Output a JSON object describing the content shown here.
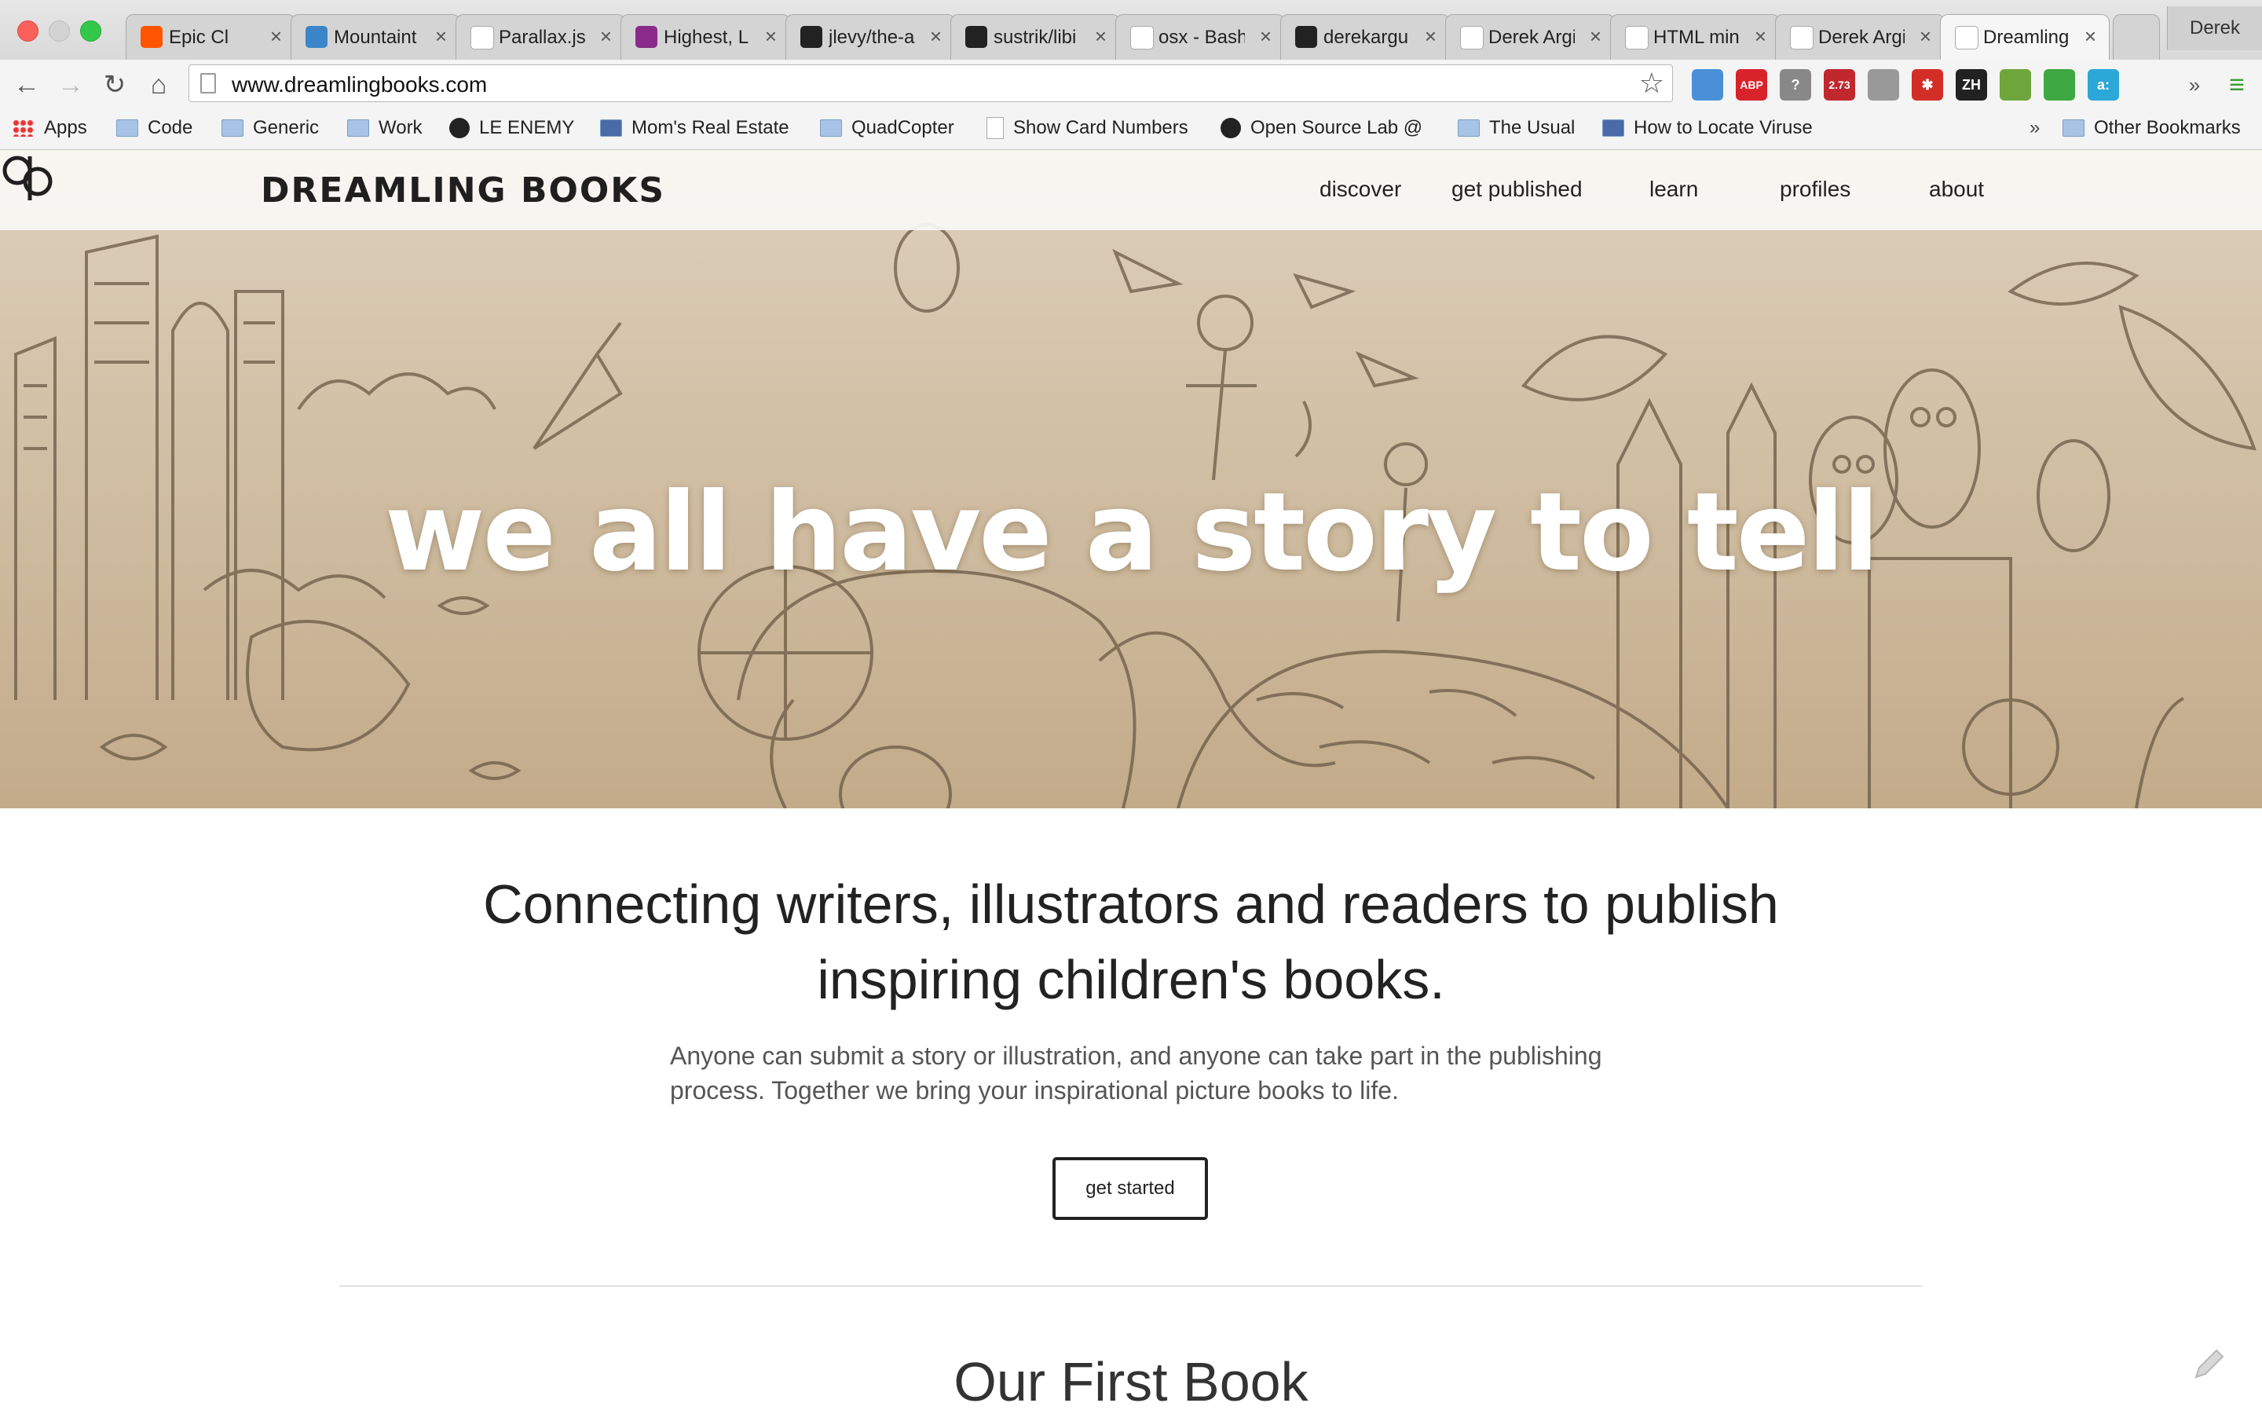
{
  "browser": {
    "tabs": [
      {
        "title": "Epic Cl",
        "favicon": "soundcloud-icon",
        "color": "#ff5500",
        "audio": true
      },
      {
        "title": "Mountaint",
        "favicon": "globe-icon",
        "color": "#3a86c8"
      },
      {
        "title": "Parallax.js",
        "favicon": "page-icon",
        "color": "#ffffff"
      },
      {
        "title": "Highest, L",
        "favicon": "brand-icon",
        "color": "#8a2a8a"
      },
      {
        "title": "jlevy/the-a",
        "favicon": "github-icon",
        "color": "#222222"
      },
      {
        "title": "sustrik/libi",
        "favicon": "github-icon",
        "color": "#222222"
      },
      {
        "title": "osx - Bash",
        "favicon": "unix-icon",
        "color": "#ffffff"
      },
      {
        "title": "derekargu",
        "favicon": "github-icon",
        "color": "#222222"
      },
      {
        "title": "Derek Argi",
        "favicon": "page-icon",
        "color": "#ffffff"
      },
      {
        "title": "HTML min",
        "favicon": "page-icon",
        "color": "#ffffff"
      },
      {
        "title": "Derek Argi",
        "favicon": "page-icon",
        "color": "#ffffff"
      },
      {
        "title": "Dreamling",
        "favicon": "dreamling-icon",
        "color": "#ffffff",
        "active": true
      }
    ],
    "profile_name": "Derek",
    "url": "www.dreamlingbooks.com",
    "extensions": [
      {
        "name": "reader-icon",
        "label": "",
        "color": "#4a90d9"
      },
      {
        "name": "adblock-plus-icon",
        "label": "ABP",
        "color": "#d9232a"
      },
      {
        "name": "help-icon",
        "label": "?",
        "color": "#888888"
      },
      {
        "name": "speedometer-icon",
        "label": "2.73",
        "color": "#c0282d"
      },
      {
        "name": "cloud-icon",
        "label": "",
        "color": "#999999"
      },
      {
        "name": "lastpass-icon",
        "label": "✱",
        "color": "#d32d27"
      },
      {
        "name": "zh-icon",
        "label": "ZH",
        "color": "#222222"
      },
      {
        "name": "evernote-icon",
        "label": "",
        "color": "#6fa63b"
      },
      {
        "name": "hangouts-icon",
        "label": "",
        "color": "#3ea842"
      },
      {
        "name": "amazon-icon",
        "label": "a:",
        "color": "#2ba7d8"
      }
    ],
    "bookmarks": [
      {
        "label": "Apps",
        "icon": "apps-icon"
      },
      {
        "label": "Code",
        "icon": "folder-icon"
      },
      {
        "label": "Generic",
        "icon": "folder-icon"
      },
      {
        "label": "Work",
        "icon": "folder-icon"
      },
      {
        "label": "LE ENEMY",
        "icon": "github-icon"
      },
      {
        "label": "Mom's Real Estate",
        "icon": "site-icon"
      },
      {
        "label": "QuadCopter",
        "icon": "folder-icon"
      },
      {
        "label": "Show Card Numbers",
        "icon": "page-icon"
      },
      {
        "label": "Open Source Lab @",
        "icon": "github-icon"
      },
      {
        "label": "The Usual",
        "icon": "folder-icon"
      },
      {
        "label": "How to Locate Viruse",
        "icon": "site-icon"
      }
    ],
    "bookmarks_overflow": "»",
    "other_bookmarks": "Other Bookmarks"
  },
  "site": {
    "brand": "DREAMLING BOOKS",
    "nav": [
      "discover",
      "get published",
      "learn",
      "profiles",
      "about"
    ],
    "hero_tagline": "we all have a story to tell",
    "headline": "Connecting writers, illustrators and readers to publish inspiring children's books.",
    "subtext": "Anyone can submit a story or illustration, and anyone can take part in the publishing process. Together we bring your inspirational picture books to life.",
    "cta_label": "get started",
    "section_title": "Our First Book",
    "colors": {
      "hero_sepia": "#cdb799",
      "hero_ink": "#6b5a45",
      "text": "#222222"
    }
  }
}
